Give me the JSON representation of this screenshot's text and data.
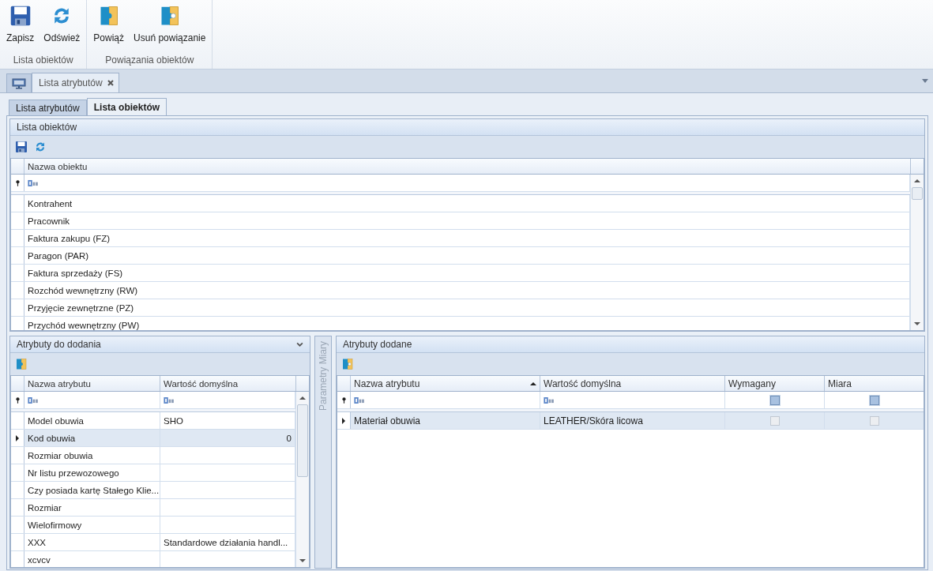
{
  "ribbon": {
    "groups": [
      {
        "label": "Lista obiektów",
        "buttons": [
          {
            "label": "Zapisz",
            "kind": "save"
          },
          {
            "label": "Odśwież",
            "kind": "refresh"
          }
        ]
      },
      {
        "label": "Powiązania obiektów",
        "buttons": [
          {
            "label": "Powiąż",
            "kind": "link"
          },
          {
            "label": "Usuń powiązanie",
            "kind": "unlink"
          }
        ]
      }
    ]
  },
  "document_tabs": [
    {
      "label": "Lista atrybutów",
      "selected": true
    }
  ],
  "inner_tabs": [
    {
      "label": "Lista atrybutów",
      "selected": false
    },
    {
      "label": "Lista obiektów",
      "selected": true
    }
  ],
  "objects_panel": {
    "title": "Lista obiektów",
    "tools": [
      {
        "kind": "save"
      },
      {
        "kind": "refresh"
      }
    ],
    "columns": [
      {
        "label": "Nazwa obiektu"
      }
    ],
    "rows": [
      {
        "name": "Kontrahent"
      },
      {
        "name": "Pracownik"
      },
      {
        "name": "Faktura zakupu (FZ)"
      },
      {
        "name": "Paragon (PAR)"
      },
      {
        "name": "Faktura sprzedaży (FS)"
      },
      {
        "name": "Rozchód wewnętrzny (RW)"
      },
      {
        "name": "Przyjęcie zewnętrzne (PZ)"
      },
      {
        "name": "Przychód wewnętrzny (PW)"
      }
    ]
  },
  "attributes_to_add": {
    "title": "Atrybuty do dodania",
    "tools": [
      {
        "kind": "link"
      }
    ],
    "columns": [
      {
        "label": "Nazwa atrybutu"
      },
      {
        "label": "Wartość domyślna"
      }
    ],
    "rows": [
      {
        "name": "Model obuwia",
        "value": "SHO",
        "kind": "text",
        "selected": false
      },
      {
        "name": "Kod obuwia",
        "value": "0",
        "kind": "number",
        "selected": true
      },
      {
        "name": "Rozmiar obuwia",
        "kind": "text",
        "selected": false
      },
      {
        "name": "Nr listu przewozowego",
        "kind": "text",
        "selected": false
      },
      {
        "name": "Czy posiada kartę Stałego Klie...",
        "kind": "text",
        "selected": false
      },
      {
        "name": "Rozmiar",
        "kind": "text",
        "selected": false
      },
      {
        "name": "Wielofirmowy",
        "kind": "text",
        "selected": false
      },
      {
        "name": "XXX",
        "value": "Standardowe działania handl...",
        "kind": "text",
        "selected": false
      },
      {
        "name": "xcvcv",
        "kind": "text",
        "selected": false
      }
    ]
  },
  "side_panel": {
    "title": "Parametry Miary"
  },
  "attributes_added": {
    "title": "Atrybuty dodane",
    "tools": [
      {
        "kind": "unlink"
      }
    ],
    "filter_row": {
      "required_indeterminate": true,
      "measure_indeterminate": true
    },
    "columns": [
      {
        "label": "Nazwa atrybutu",
        "sorted": true
      },
      {
        "label": "Wartość domyślna",
        "sorted": false
      },
      {
        "label": "Wymagany",
        "sorted": false
      },
      {
        "label": "Miara",
        "sorted": false
      }
    ],
    "rows": [
      {
        "name": "Materiał obuwia",
        "value": "LEATHER/Skóra licowa",
        "required": false,
        "measure": false,
        "selected": true
      }
    ]
  }
}
